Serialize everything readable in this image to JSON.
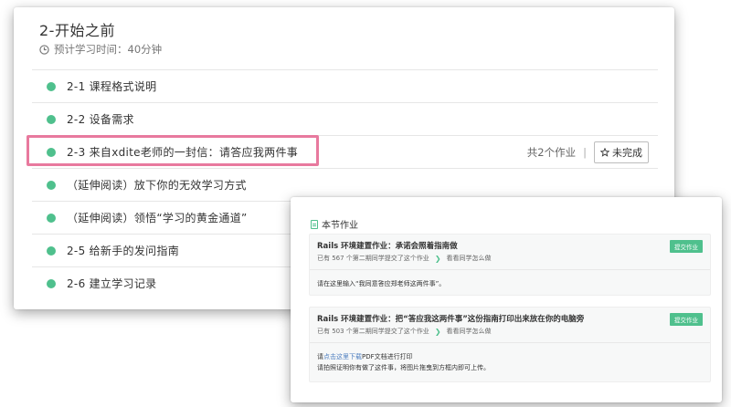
{
  "section": {
    "title": "2-开始之前",
    "estimated_time": "预计学习时间：40分钟"
  },
  "lessons": [
    {
      "label": "2-1 课程格式说明"
    },
    {
      "label": "2-2 设备需求"
    },
    {
      "label": "2-3 来自xdite老师的一封信：请答应我两件事"
    },
    {
      "label": "（延伸阅读）放下你的无效学习方式"
    },
    {
      "label": "（延伸阅读）领悟“学习的黄金通道”"
    },
    {
      "label": "2-5 给新手的发问指南"
    },
    {
      "label": "2-6 建立学习记录"
    }
  ],
  "lesson_meta": {
    "homework_count": "共2个作业",
    "separator": "|",
    "status_button": "未完成"
  },
  "homework": {
    "title": "本节作业",
    "items": [
      {
        "title": "Rails 环境建置作业：承诺会照着指南做",
        "submit_label": "提交作业",
        "count_text": "已有 567 个第二期同学提交了这个作业",
        "view_link": "看看同学怎么做",
        "note_line1": "请在这里输入“我同意答应郑老师这两件事”。",
        "note_line2": ""
      },
      {
        "title": "Rails 环境建置作业：把“答应我这两件事”这份指南打印出来放在你的电脑旁",
        "submit_label": "提交作业",
        "count_text": "已有 503 个第二期同学提交了这个作业",
        "view_link": "看看同学怎么做",
        "note_link": "点击这里下载",
        "note_line1_prefix": "请",
        "note_line1_suffix": "PDF文档进行打印",
        "note_line2": "请拍照证明你有做了这件事，将图片拖曳到方框内即可上传。"
      }
    ]
  },
  "colors": {
    "accent": "#4fc08d",
    "highlight": "#e8799e",
    "link": "#4f7fc0"
  }
}
